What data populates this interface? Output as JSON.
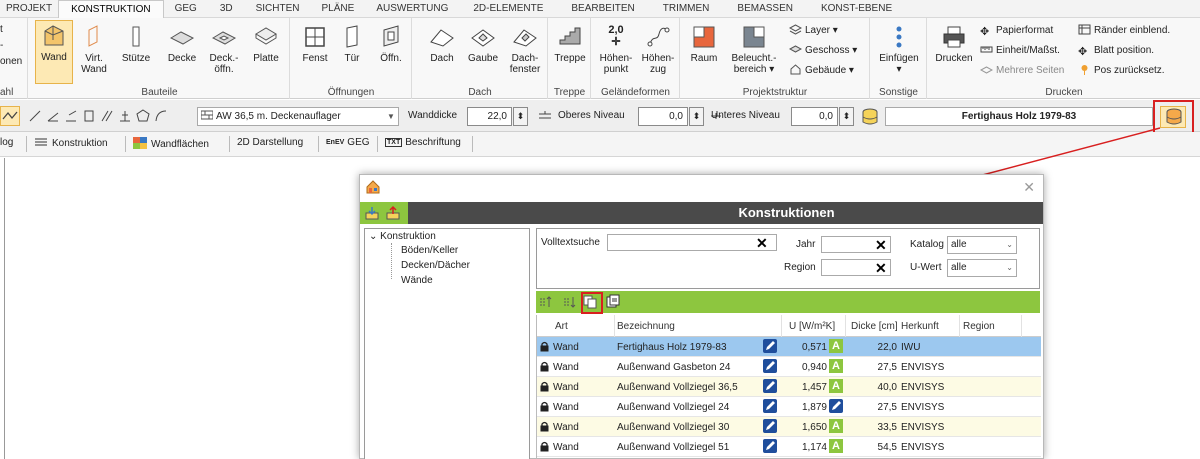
{
  "menu": {
    "tabs": [
      "PROJEKT",
      "KONSTRUKTION",
      "GEG",
      "3D",
      "SICHTEN",
      "PLÄNE",
      "AUSWERTUNG",
      "2D-ELEMENTE",
      "BEARBEITEN",
      "TRIMMEN",
      "BEMASSEN",
      "KONST-EBENE"
    ],
    "active": "KONSTRUKTION"
  },
  "ribbon": {
    "left_partial": {
      "line1": "t",
      "line2": "-",
      "line3": "onen",
      "group": "ahl"
    },
    "bauteile": {
      "label": "Bauteile",
      "buttons": [
        {
          "id": "wand",
          "label": "Wand"
        },
        {
          "id": "virt",
          "label": "Virt.\nWand"
        },
        {
          "id": "stuetze",
          "label": "Stütze"
        },
        {
          "id": "decke",
          "label": "Decke"
        },
        {
          "id": "deckoeffn",
          "label": "Deck.-\nöffn."
        },
        {
          "id": "platte",
          "label": "Platte"
        }
      ]
    },
    "oeffnungen": {
      "label": "Öffnungen",
      "buttons": [
        {
          "label": "Fenst"
        },
        {
          "label": "Tür"
        },
        {
          "label": "Öffn."
        }
      ]
    },
    "dach": {
      "label": "Dach",
      "buttons": [
        {
          "label": "Dach"
        },
        {
          "label": "Gaube"
        },
        {
          "label": "Dach-\nfenster"
        }
      ]
    },
    "treppe": {
      "label": "Treppe",
      "buttons": [
        {
          "label": "Treppe"
        }
      ]
    },
    "gelaende": {
      "label": "Geländeformen",
      "buttons": [
        {
          "label": "Höhen-\npunkt",
          "icon_text": "2,0"
        },
        {
          "label": "Höhen-\nzug"
        }
      ]
    },
    "projektstruktur": {
      "label": "Projektstruktur",
      "buttons": [
        {
          "label": "Raum"
        },
        {
          "label": "Beleucht.-\nbereich ▾"
        }
      ],
      "small": [
        {
          "label": "Layer ▾"
        },
        {
          "label": "Geschoss ▾"
        },
        {
          "label": "Gebäude ▾"
        }
      ]
    },
    "sonstige": {
      "label": "Sonstige",
      "buttons": [
        {
          "label": "Einfügen\n▾"
        }
      ]
    },
    "drucken": {
      "label": "Drucken",
      "buttons": [
        {
          "label": "Drucken"
        }
      ],
      "small": [
        {
          "label": "Papierformat"
        },
        {
          "label": "Einheit/Maßst."
        },
        {
          "label": "Mehrere Seiten"
        },
        {
          "label": "Ränder einblend."
        },
        {
          "label": "Blatt position."
        },
        {
          "label": "Pos zurücksetz."
        }
      ]
    }
  },
  "toolbar2": {
    "wall_type": "AW 36,5 m. Deckenauflager",
    "wanddicke_label": "Wanddicke",
    "wanddicke_value": "22,0",
    "oberes_label": "Oberes Niveau",
    "oberes_value": "0,0",
    "unteres_label": "Unteres Niveau",
    "unteres_value": "0,0",
    "construction_name": "Fertighaus Holz 1979-83"
  },
  "toolbar3": {
    "items": [
      {
        "label": "log"
      },
      {
        "label": "Konstruktion"
      },
      {
        "label": "Wandflächen"
      },
      {
        "label": "2D Darstellung"
      },
      {
        "label": "GEG",
        "prefix": "EnEV"
      },
      {
        "label": "Beschriftung",
        "prefix": "TXT"
      }
    ]
  },
  "dialog": {
    "title": "Konstruktionen",
    "tree": {
      "root": "Konstruktion",
      "children": [
        "Böden/Keller",
        "Decken/Dächer",
        "Wände"
      ]
    },
    "search": {
      "volltext_label": "Volltextsuche",
      "volltext_value": "",
      "jahr_label": "Jahr",
      "jahr_value": "",
      "region_label": "Region",
      "region_value": "",
      "katalog_label": "Katalog",
      "katalog_value": "alle",
      "uwert_label": "U-Wert",
      "uwert_value": "alle"
    },
    "table": {
      "headers": [
        "Art",
        "Bezeichnung",
        "U [W/m²K]",
        "Dicke [cm]",
        "Herkunft",
        "Region"
      ],
      "rows": [
        {
          "art": "Wand",
          "bez": "Fertighaus Holz 1979-83",
          "u": "0,571",
          "cls": "A",
          "dicke": "22,0",
          "herkunft": "IWU",
          "selected": true
        },
        {
          "art": "Wand",
          "bez": "Außenwand Gasbeton 24",
          "u": "0,940",
          "cls": "A",
          "dicke": "27,5",
          "herkunft": "ENVISYS"
        },
        {
          "art": "Wand",
          "bez": "Außenwand Vollziegel 36,5",
          "u": "1,457",
          "cls": "A",
          "dicke": "40,0",
          "herkunft": "ENVISYS"
        },
        {
          "art": "Wand",
          "bez": "Außenwand Vollziegel 24",
          "u": "1,879",
          "cls": "",
          "dicke": "27,5",
          "herkunft": "ENVISYS"
        },
        {
          "art": "Wand",
          "bez": "Außenwand Vollziegel 30",
          "u": "1,650",
          "cls": "A",
          "dicke": "33,5",
          "herkunft": "ENVISYS"
        },
        {
          "art": "Wand",
          "bez": "Außenwand Vollziegel 51",
          "u": "1,174",
          "cls": "A",
          "dicke": "54,5",
          "herkunft": "ENVISYS"
        }
      ]
    }
  },
  "colors": {
    "accent_green": "#8dc63f",
    "header_dark": "#4a4a4a",
    "selected_row": "#9cc8ef",
    "highlight_red": "#d81f1f",
    "selected_button": "#fde9b4"
  }
}
